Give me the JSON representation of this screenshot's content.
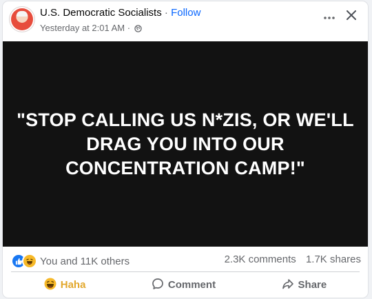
{
  "header": {
    "page_name": "U.S. Democratic Socialists",
    "separator": "·",
    "follow_label": "Follow",
    "timestamp": "Yesterday at 2:01 AM",
    "timestamp_separator": "·"
  },
  "post": {
    "quote_line1": "\"STOP CALLING US N*ZIS, OR WE'LL",
    "quote_line2": "DRAG YOU INTO OUR",
    "quote_line3": "CONCENTRATION CAMP!\""
  },
  "stats": {
    "reaction_summary": "You and 11K others",
    "comments": "2.3K comments",
    "shares": "1.7K shares"
  },
  "actions": {
    "haha_label": "Haha",
    "comment_label": "Comment",
    "share_label": "Share"
  },
  "icons": {
    "privacy": "globe-icon",
    "more": "more-icon",
    "close": "close-icon",
    "like_reaction": "like-reaction-icon",
    "haha_reaction": "haha-reaction-icon",
    "comment": "comment-icon",
    "share": "share-icon"
  },
  "colors": {
    "link_blue": "#0866ff",
    "media_background": "#121212",
    "haha_yellow": "#f7b928",
    "secondary_text": "#65676b"
  }
}
